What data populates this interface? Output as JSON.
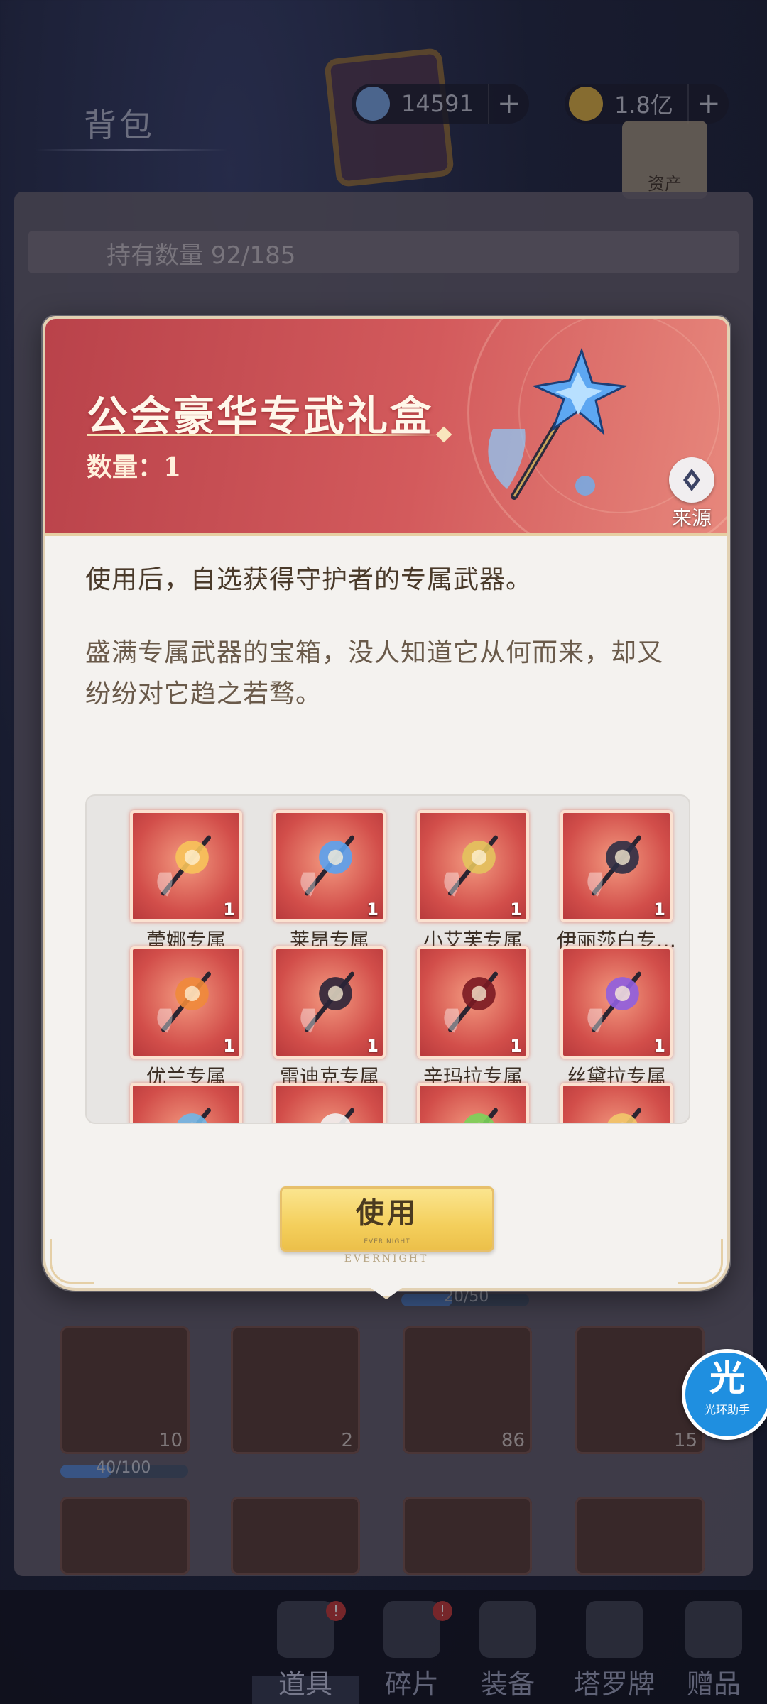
{
  "background": {
    "title": "背包",
    "currencies": [
      {
        "name": "gem",
        "value": "14591",
        "icon": "gem-icon",
        "color": "#7aa7e6"
      },
      {
        "name": "gold",
        "value": "1.8亿",
        "icon": "gold-coin-icon",
        "color": "#e0b446"
      }
    ],
    "assets_label": "资产",
    "count_label": "持有数量 92/185",
    "grid_counts": [
      "10",
      "2",
      "86",
      "15"
    ],
    "bars": [
      "20/50",
      "40/100"
    ],
    "bottom_nav": [
      {
        "label": "道具",
        "badge": "!",
        "active": true
      },
      {
        "label": "碎片",
        "badge": "!",
        "active": false
      },
      {
        "label": "装备",
        "badge": "",
        "active": false
      },
      {
        "label": "塔罗牌",
        "badge": "",
        "active": false
      },
      {
        "label": "赠品",
        "badge": "",
        "active": false
      }
    ]
  },
  "modal": {
    "title": "公会豪华专武礼盒",
    "quantity": "数量：1",
    "source_label": "来源",
    "description": "使用后，自选获得守护者的专属武器。",
    "flavor": "盛满专属武器的宝箱，没人知道它从何而来，却又纷纷对它趋之若骛。",
    "rewards": [
      {
        "name": "蕾娜专属",
        "qty": "1",
        "icon": "flame-rings-weapon-icon",
        "hue": "#f7c35a"
      },
      {
        "name": "莱昂专属",
        "qty": "1",
        "icon": "crystal-axe-weapon-icon",
        "hue": "#5aa2f0"
      },
      {
        "name": "小艾芙专属",
        "qty": "1",
        "icon": "golden-harp-weapon-icon",
        "hue": "#e3c35d"
      },
      {
        "name": "伊丽莎白专…",
        "qty": "1",
        "icon": "lace-fan-weapon-icon",
        "hue": "#2d2f45"
      },
      {
        "name": "优兰专属",
        "qty": "1",
        "icon": "phoenix-book-weapon-icon",
        "hue": "#f08a3a"
      },
      {
        "name": "雷迪克专属",
        "qty": "1",
        "icon": "dark-blade-weapon-icon",
        "hue": "#2b2538"
      },
      {
        "name": "辛玛拉专属",
        "qty": "1",
        "icon": "scythe-weapon-icon",
        "hue": "#7a1a22"
      },
      {
        "name": "丝黛拉专属",
        "qty": "1",
        "icon": "violet-orb-weapon-icon",
        "hue": "#8f5fe0"
      },
      {
        "name": "",
        "qty": "",
        "icon": "partial-weapon-icon",
        "hue": "#6fb7e8"
      },
      {
        "name": "",
        "qty": "",
        "icon": "partial-weapon-icon",
        "hue": "#f1f1f1"
      },
      {
        "name": "",
        "qty": "",
        "icon": "partial-weapon-icon",
        "hue": "#7ad45a"
      },
      {
        "name": "",
        "qty": "",
        "icon": "partial-weapon-icon",
        "hue": "#f2c86a"
      }
    ],
    "use_button": "使用",
    "use_button_sub": "EVER NIGHT",
    "brand": "EVERNIGHT"
  },
  "floating_helper": {
    "glyph": "光",
    "label": "光环助手"
  }
}
